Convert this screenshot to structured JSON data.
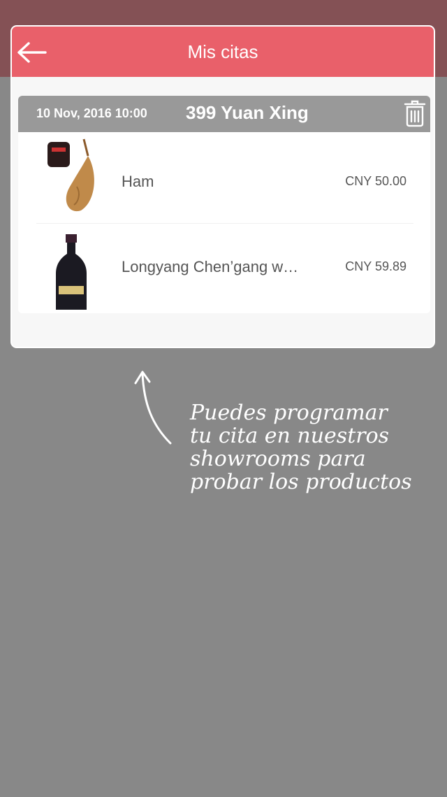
{
  "header": {
    "title": "Mis citas"
  },
  "appointment": {
    "date": "10 Nov, 2016 10:00",
    "store": "399 Yuan Xing",
    "items": [
      {
        "name": "Ham",
        "price": "CNY 50.00",
        "image_icon": "ham-image"
      },
      {
        "name": "Longyang Chen’gang w…",
        "price": "CNY 59.89",
        "image_icon": "wine-bottle-image"
      }
    ]
  },
  "hint": {
    "lines": [
      "Puedes programar",
      "tu cita en nuestros",
      "showrooms para",
      "probar los productos"
    ]
  },
  "colors": {
    "header": "#e9606a",
    "overlay": "#888888",
    "appointment_bar": "#999999"
  }
}
